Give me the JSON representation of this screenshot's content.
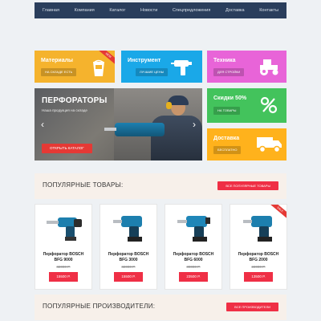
{
  "nav": {
    "items": [
      "Главная",
      "Компания",
      "Каталог",
      "Новости",
      "Спецпредложения",
      "Доставка",
      "Контакты"
    ]
  },
  "tiles": {
    "materials": {
      "title": "Материалы",
      "button": "НА СКЛАДЕ ЕСТЬ",
      "ribbon": "NEW"
    },
    "tools": {
      "title": "Инструмент",
      "button": "ЛУЧШИЕ ЦЕНЫ"
    },
    "tech": {
      "title": "Техника",
      "button": "ДЛЯ СТРОЙКИ"
    },
    "discounts": {
      "title": "Скидки 50%",
      "button": "НА ТОВАРЫ"
    },
    "delivery": {
      "title": "Доставка",
      "button": "БЕСПЛАТНО"
    }
  },
  "banner": {
    "title": "ПЕРФОРАТОРЫ",
    "subtitle": "Наша продукция на складе",
    "cta": "ОТКРЫТЬ КАТАЛОГ",
    "prev": "‹",
    "next": "›"
  },
  "popular": {
    "title": "ПОПУЛЯРНЫЕ ТОВАРЫ:",
    "button": "ВСЕ ПОПУЛЯРНЫЕ ТОВАРЫ",
    "products": [
      {
        "name_line1": "Перфоратор BOSCH",
        "name_line2": "BFG 9000",
        "old_price": "32000 Р.",
        "price": "15500 Р.",
        "ribbon": ""
      },
      {
        "name_line1": "Перфоратор BOSCH",
        "name_line2": "BFG 3000",
        "old_price": "32000 Р.",
        "price": "15500 Р.",
        "ribbon": ""
      },
      {
        "name_line1": "Перфоратор BOSCH",
        "name_line2": "BFG 6000",
        "old_price": "30000 Р.",
        "price": "23500 Р.",
        "ribbon": ""
      },
      {
        "name_line1": "Перфоратор BOSCH",
        "name_line2": "BFG 2000",
        "old_price": "22000 Р.",
        "price": "13500 Р.",
        "ribbon": "SALE"
      }
    ]
  },
  "manufacturers": {
    "title": "ПОПУЛЯРНЫЕ ПРОИЗВОДИТЕЛИ:",
    "button": "ВСЕ ПРОИЗВОДИТЕЛИ"
  },
  "colors": {
    "nav": "#2a3e5c",
    "materials": "#f5b32d",
    "tools": "#1aa8e8",
    "tech": "#e864d8",
    "discounts": "#43c35c",
    "delivery": "#ffb21c",
    "accent": "#ef2f45"
  }
}
